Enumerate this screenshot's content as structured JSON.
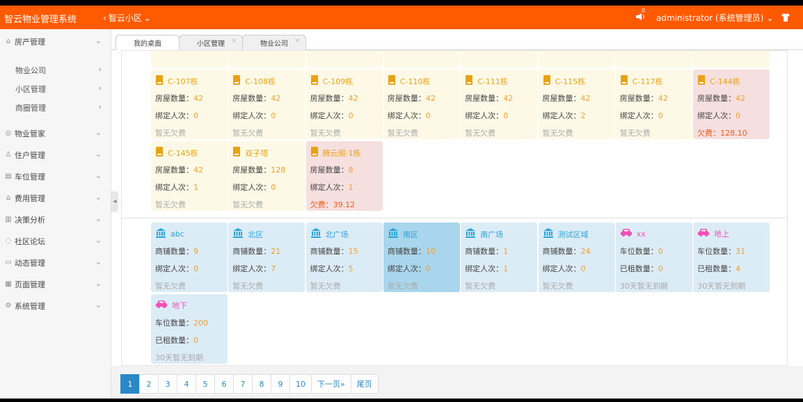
{
  "header": {
    "app_title": "智云物业管理系统",
    "community": "智云小区",
    "notify_count": "0",
    "user": "administrator (系统管理员)"
  },
  "sidebar": {
    "items": [
      {
        "label": "房产管理",
        "icon": "home-icon"
      },
      {
        "label": "物业管家",
        "icon": "steward-icon"
      },
      {
        "label": "住户管理",
        "icon": "people-icon"
      },
      {
        "label": "车位管理",
        "icon": "parking-icon"
      },
      {
        "label": "费用管理",
        "icon": "fee-icon"
      },
      {
        "label": "决策分析",
        "icon": "chart-icon"
      },
      {
        "label": "社区论坛",
        "icon": "forum-icon"
      },
      {
        "label": "动态管理",
        "icon": "news-icon"
      },
      {
        "label": "页面管理",
        "icon": "page-icon"
      },
      {
        "label": "系统管理",
        "icon": "gear-icon"
      }
    ],
    "sub_items": [
      {
        "label": "物业公司"
      },
      {
        "label": "小区管理"
      },
      {
        "label": "商圈管理"
      }
    ]
  },
  "tabs": [
    {
      "label": "我的桌面"
    },
    {
      "label": "小区管理"
    },
    {
      "label": "物业公司"
    }
  ],
  "labels": {
    "house_count": "房屋数量：",
    "bind_count": "绑定人次：",
    "shop_count": "商铺数量：",
    "space_count": "车位数量：",
    "rented_count": "已租数量：",
    "no_arrears": "暂无欠费",
    "arrears": "欠费：",
    "no_expire": "30天暂无到期"
  },
  "buildings": [
    {
      "name": "C-107栋",
      "houses": "42",
      "bound": "0",
      "status": "暂无欠费",
      "owe": false
    },
    {
      "name": "C-108栋",
      "houses": "42",
      "bound": "0",
      "status": "暂无欠费",
      "owe": false
    },
    {
      "name": "C-109栋",
      "houses": "42",
      "bound": "0",
      "status": "暂无欠费",
      "owe": false
    },
    {
      "name": "C-110栋",
      "houses": "42",
      "bound": "0",
      "status": "暂无欠费",
      "owe": false
    },
    {
      "name": "C-111栋",
      "houses": "42",
      "bound": "0",
      "status": "暂无欠费",
      "owe": false
    },
    {
      "name": "C-115栋",
      "houses": "42",
      "bound": "2",
      "status": "暂无欠费",
      "owe": false
    },
    {
      "name": "C-117栋",
      "houses": "42",
      "bound": "0",
      "status": "暂无欠费",
      "owe": false
    },
    {
      "name": "C-144栋",
      "houses": "42",
      "bound": "0",
      "status": "128.10",
      "owe": true
    },
    {
      "name": "C-145栋",
      "houses": "42",
      "bound": "1",
      "status": "暂无欠费",
      "owe": false
    },
    {
      "name": "双子塔",
      "houses": "128",
      "bound": "0",
      "status": "暂无欠费",
      "owe": false
    },
    {
      "name": "腾云阁-1栋",
      "houses": "8",
      "bound": "1",
      "status": "39.12",
      "owe": true
    }
  ],
  "shops": [
    {
      "name": "abc",
      "count": "9",
      "bound": "0",
      "status": "暂无欠费"
    },
    {
      "name": "北区",
      "count": "21",
      "bound": "7",
      "status": "暂无欠费"
    },
    {
      "name": "北广场",
      "count": "15",
      "bound": "5",
      "status": "暂无欠费"
    },
    {
      "name": "南区",
      "count": "10",
      "bound": "0",
      "status": "暂无欠费"
    },
    {
      "name": "南广场",
      "count": "1",
      "bound": "1",
      "status": "暂无欠费"
    },
    {
      "name": "测试区域",
      "count": "24",
      "bound": "0",
      "status": "暂无欠费"
    }
  ],
  "parkings": [
    {
      "name": "xx",
      "count": "0",
      "rented": "0",
      "status": "30天暂无到期"
    },
    {
      "name": "地上",
      "count": "31",
      "rented": "4",
      "status": "30天暂无到期"
    },
    {
      "name": "地下",
      "count": "200",
      "rented": "0",
      "status": "30天暂无到期"
    }
  ],
  "pagination": {
    "pages": [
      "1",
      "2",
      "3",
      "4",
      "5",
      "6",
      "7",
      "8",
      "9",
      "10"
    ],
    "next": "下一页»",
    "last": "尾页",
    "current": "1"
  },
  "colors": {
    "header_bg": "#ff5a00",
    "building_title": "#e8a315",
    "shop_title": "#2aa5d8",
    "parking_title": "#f052b6",
    "value": "#f0a030",
    "owe": "#f05a1a"
  }
}
